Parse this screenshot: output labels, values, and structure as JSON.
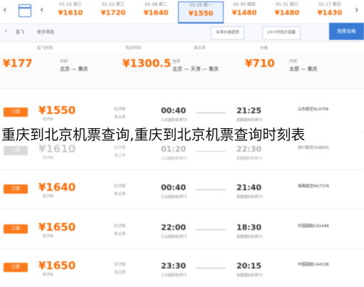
{
  "date_strip": {
    "days": [
      {
        "date": "",
        "price": ""
      },
      {
        "date": "01-15 周三",
        "price": "¥1610"
      },
      {
        "date": "01-22 周三",
        "price": "¥1720"
      },
      {
        "date": "01-28 周二",
        "price": "¥1640"
      },
      {
        "date": "01-29 周一",
        "price": "¥1550"
      },
      {
        "date": "01-30 周四",
        "price": "¥1480"
      },
      {
        "date": "01-31 周六",
        "price": "¥1480"
      },
      {
        "date": "01-17 周日",
        "price": "¥1430"
      }
    ]
  },
  "filter_bar": {
    "filter_label": "直飞",
    "sort_label": "更多筛选",
    "tab_airport": "未来价格趋势",
    "tab_trend": "24小时低价提醒",
    "blue_tab": "购票攻略"
  },
  "sort_row": [
    "起飞时间",
    "到达时间",
    "准点率",
    "价格"
  ],
  "transfer": {
    "cards": [
      {
        "price": "¥177",
        "cities": "北京 — 重庆",
        "note": "中转"
      },
      {
        "price": "¥1300.5",
        "cities": "北京 — 天津 — 重庆",
        "note": "经停"
      },
      {
        "price": "¥710",
        "cities": "太原 — 重庆",
        "note": "中转"
      }
    ]
  },
  "flights": [
    {
      "price": "¥1550",
      "price_note": "经济舱",
      "class": "经济舱",
      "rate": "准点率",
      "arrive": "00:40",
      "arrive_airport": "江北国际机场T3",
      "depart": "21:25",
      "depart_airport": "首都国际机场T3",
      "airline": "山东航空SC4756",
      "badge": "",
      "book": "订票"
    },
    {
      "price": "¥1610",
      "price_note": "经济舱",
      "class": "经济舱",
      "rate": "准点率",
      "arrive": "01:20",
      "arrive_airport": "江北国际机场T3",
      "depart": "22:30",
      "depart_airport": "首都国际机场T3",
      "airline": "四川航空3U8830",
      "badge": "",
      "book": "订票"
    },
    {
      "price": "¥1640",
      "price_note": "经济舱",
      "class": "经济舱",
      "rate": "准点率",
      "arrive": "00:40",
      "arrive_airport": "江北国际机场T3",
      "depart": "21:40",
      "depart_airport": "首都国际机场T3",
      "airline": "海南航空HU7376",
      "badge": "",
      "book": "订票"
    },
    {
      "price": "¥1650",
      "price_note": "经济舱",
      "class": "经济舱",
      "rate": "准点率",
      "arrive": "22:00",
      "arrive_airport": "江北国际机场T3",
      "depart": "18:30",
      "depart_airport": "首都国际机场T3",
      "airline": "中国国航CA1448",
      "badge": "",
      "book": "订票"
    },
    {
      "price": "¥1650",
      "price_note": "经济舱",
      "class": "经济舱",
      "rate": "准点率",
      "arrive": "23:30",
      "arrive_airport": "江北国际机场T3",
      "depart": "20:15",
      "depart_airport": "首都国际机场T3",
      "airline": "中国国航CA4138",
      "badge": "",
      "book": "订票"
    }
  ],
  "caption": "重庆到北京机票查询,重庆到北京机票查询时刻表",
  "colors": {
    "accent": "#3a7bd5",
    "price": "#ff6a00",
    "book_button": "#ff7a1a"
  }
}
